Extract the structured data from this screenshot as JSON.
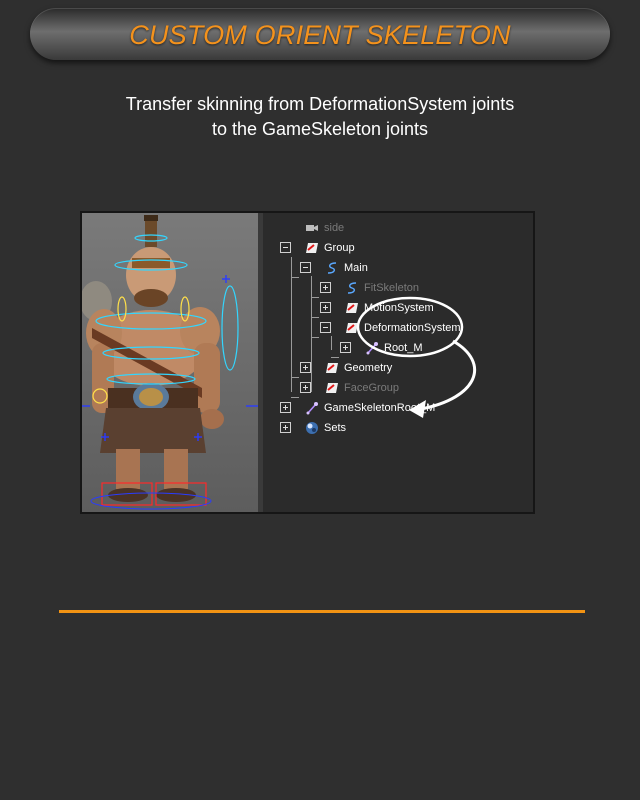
{
  "banner": {
    "title": "CUSTOM ORIENT SKELETON"
  },
  "caption": {
    "line1": "Transfer skinning from DeformationSystem joints",
    "line2": "to the GameSkeleton joints"
  },
  "outliner": {
    "items": [
      {
        "label": "side",
        "icon": "camera-icon",
        "dim": true
      },
      {
        "label": "Group",
        "icon": "transform-icon",
        "expanded": true
      },
      {
        "label": "Main",
        "icon": "curve-icon",
        "expanded": true
      },
      {
        "label": "FitSkeleton",
        "icon": "curve-icon",
        "dim": true
      },
      {
        "label": "MotionSystem",
        "icon": "transform-icon"
      },
      {
        "label": "DeformationSystem",
        "icon": "transform-icon",
        "expanded": true
      },
      {
        "label": "Root_M",
        "icon": "joint-icon"
      },
      {
        "label": "Geometry",
        "icon": "transform-icon"
      },
      {
        "label": "FaceGroup",
        "icon": "transform-icon",
        "dim": true
      },
      {
        "label": "GameSkeletonRoot_M",
        "icon": "joint-icon"
      },
      {
        "label": "Sets",
        "icon": "sets-icon"
      }
    ]
  },
  "colors": {
    "accent": "#f4921c",
    "annotation": "#ffffff",
    "viewport_background": "#6b6b6b",
    "outliner_background": "#2b2b2b"
  }
}
